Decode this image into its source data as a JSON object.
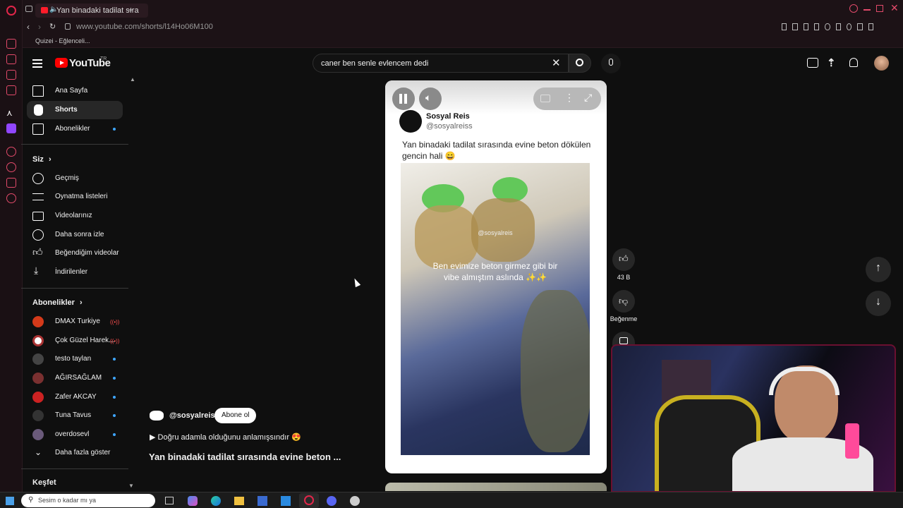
{
  "browser": {
    "tab_title": "Yan binadaki tadilat sıra",
    "url": "www.youtube.com/shorts/l14Ho06M100",
    "bookmark": "Quizei - Eğlenceli..."
  },
  "header": {
    "logo_text": "YouTube",
    "region": "TR",
    "search_value": "caner ben senle evlencem dedi"
  },
  "sidebar": {
    "main": [
      {
        "label": "Ana Sayfa"
      },
      {
        "label": "Shorts"
      },
      {
        "label": "Abonelikler"
      }
    ],
    "you_heading": "Siz",
    "you_items": [
      {
        "label": "Geçmiş"
      },
      {
        "label": "Oynatma listeleri"
      },
      {
        "label": "Videolarınız"
      },
      {
        "label": "Daha sonra izle"
      },
      {
        "label": "Beğendiğim videolar"
      },
      {
        "label": "İndirilenler"
      }
    ],
    "subs_heading": "Abonelikler",
    "subs": [
      {
        "label": "DMAX Turkiye",
        "status": "live"
      },
      {
        "label": "Çok Güzel Harek...",
        "status": "live"
      },
      {
        "label": "testo taylan",
        "status": "new"
      },
      {
        "label": "AĞIRSAĞLAM",
        "status": "new"
      },
      {
        "label": "Zafer AKCAY",
        "status": "new"
      },
      {
        "label": "Tuna Tavus",
        "status": "new"
      },
      {
        "label": "overdosevl",
        "status": "new"
      }
    ],
    "show_more": "Daha fazla göster",
    "explore_heading": "Keşfet"
  },
  "short": {
    "channel_name": "Sosyal Reis",
    "channel_handle": "@sosyalreiss",
    "post_text": "Yan binadaki tadilat sırasında evine beton dökülen gencin hali 😄",
    "video_watermark": "@sosyalreis",
    "video_caption": "Ben evimize beton girmez gibi bir vibe almıştım aslında ✨✨",
    "info_handle": "@sosyalreis",
    "subscribe_label": "Abone ol",
    "link_text": "▶ Doğru adamla olduğunu anlamışsındır 😍",
    "title": "Yan binadaki tadilat sırasında evine beton ..."
  },
  "actions": {
    "likes": "43 B",
    "dislike_label": "Beğenme"
  },
  "taskbar": {
    "search_text": "Sesim o kadar mı ya"
  },
  "colors": {
    "yt_red": "#ff0000",
    "browser_accent": "#e24a6a",
    "link_blue": "#3ea6ff"
  }
}
